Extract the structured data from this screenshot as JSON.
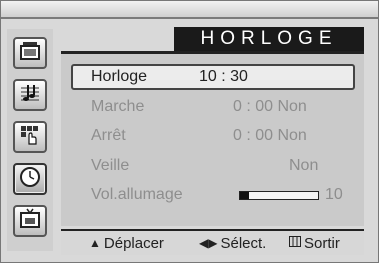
{
  "menu": {
    "title": "HORLOGE",
    "items": [
      {
        "label": "Horloge",
        "value": "10 : 30",
        "selected": true
      },
      {
        "label": "Marche",
        "value": "0 : 00 Non"
      },
      {
        "label": "Arrêt",
        "value": "0 : 00 Non"
      },
      {
        "label": "Veille",
        "value": "Non"
      },
      {
        "label": "Vol.allumage",
        "value": "10",
        "level_fraction": 0.12
      }
    ]
  },
  "footer": {
    "move_label": "Déplacer",
    "select_label": "Sélect.",
    "exit_label": "Sortir"
  },
  "sidebar": {
    "icons": [
      "picture-icon",
      "music-note-icon",
      "hand-grid-icon",
      "clock-icon",
      "tv-input-icon"
    ]
  },
  "colors": {
    "title_bg": "#1a1a1a",
    "panel_bg": "#cacaca",
    "selected_bg": "#ececec"
  }
}
